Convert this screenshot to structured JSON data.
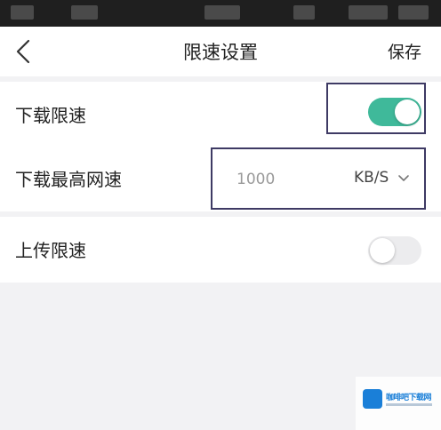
{
  "nav": {
    "title": "限速设置",
    "save_label": "保存",
    "back_icon": "chevron-left-icon"
  },
  "settings": {
    "download_limit": {
      "label": "下载限速",
      "enabled": true
    },
    "max_download_speed": {
      "label": "下载最高网速",
      "value": "1000",
      "unit": "KB/S",
      "dropdown_icon": "chevron-down-icon"
    },
    "upload_limit": {
      "label": "上传限速",
      "enabled": false
    }
  },
  "watermark": {
    "text": "咖啡吧下载网"
  },
  "colors": {
    "toggle_on": "#3fb99a",
    "toggle_off": "#ececee",
    "highlight_border": "#3e3a64",
    "background": "#f2f2f4"
  }
}
